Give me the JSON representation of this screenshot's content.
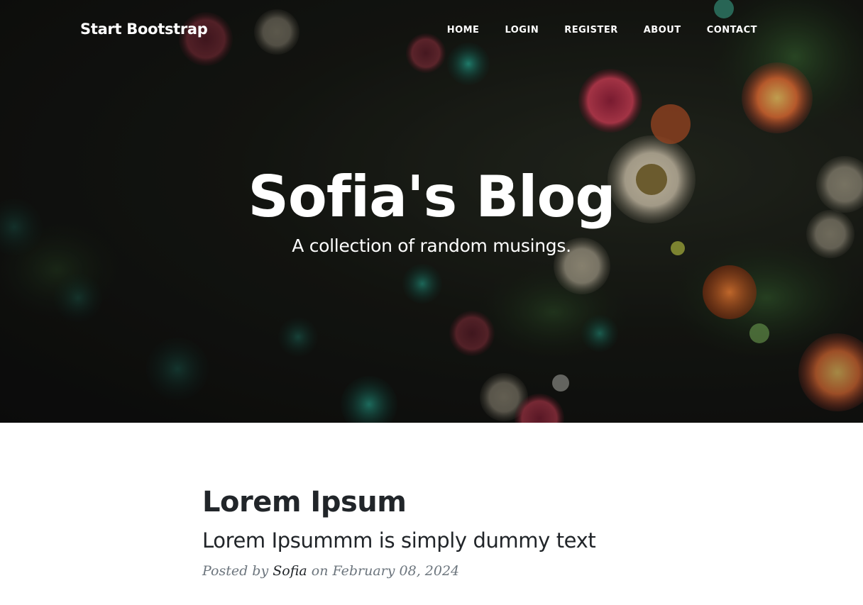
{
  "navbar": {
    "brand": "Start Bootstrap",
    "links": [
      "HOME",
      "LOGIN",
      "REGISTER",
      "ABOUT",
      "CONTACT"
    ]
  },
  "hero": {
    "title": "Sofia's Blog",
    "subtitle": "A collection of random musings."
  },
  "post": {
    "title": "Lorem Ipsum",
    "subtitle": "Lorem Ipsummm is simply dummy text",
    "meta_prefix": "Posted by",
    "author": "Sofia",
    "meta_on": "on",
    "date": "February 08, 2024"
  },
  "colors": {
    "text_dark": "#212529",
    "meta_gray": "#6c757d",
    "hero_text": "#ffffff"
  }
}
